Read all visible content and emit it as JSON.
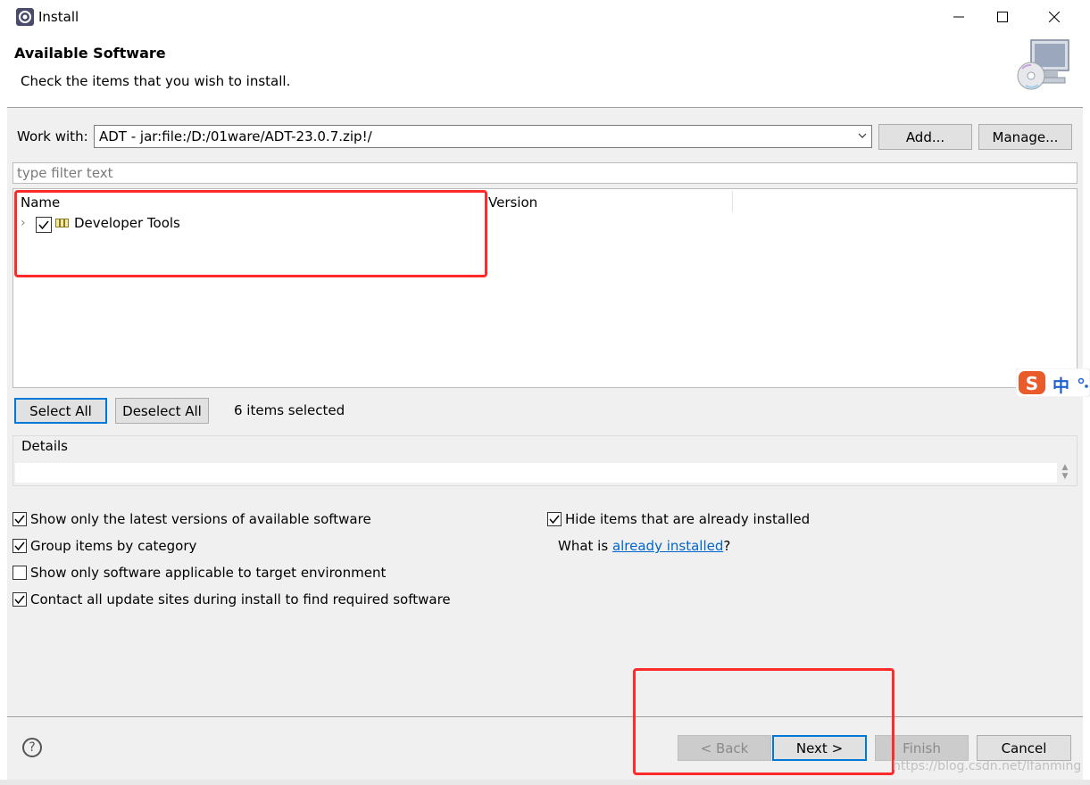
{
  "window": {
    "title": "Install"
  },
  "header": {
    "title": "Available Software",
    "description": "Check the items that you wish to install."
  },
  "work_with": {
    "label": "Work with:",
    "value": "ADT - jar:file:/D:/01ware/ADT-23.0.7.zip!/",
    "add_button": "Add...",
    "manage_button": "Manage..."
  },
  "filter": {
    "placeholder": "type filter text"
  },
  "tree": {
    "columns": [
      "Name",
      "Version"
    ],
    "rows": [
      {
        "label": "Developer Tools",
        "checked": true,
        "version": ""
      }
    ]
  },
  "selection": {
    "select_all": "Select All",
    "deselect_all": "Deselect All",
    "status": "6 items selected"
  },
  "details": {
    "label": "Details"
  },
  "options": [
    {
      "label": "Show only the latest versions of available software",
      "checked": true
    },
    {
      "label": "Group items by category",
      "checked": true
    },
    {
      "label": "Show only software applicable to target environment",
      "checked": false
    },
    {
      "label": "Contact all update sites during install to find required software",
      "checked": true
    },
    {
      "label": "Hide items that are already installed",
      "checked": true
    }
  ],
  "whatis": {
    "prefix": "What is ",
    "link": "already installed",
    "suffix": "?"
  },
  "footer": {
    "back": "< Back",
    "next": "Next >",
    "finish": "Finish",
    "cancel": "Cancel"
  },
  "ime": {
    "label": "中"
  },
  "watermark": "https://blog.csdn.net/lfanming",
  "colors": {
    "accent": "#0078d7",
    "annotation": "#ff2a2a",
    "link": "#0066cc"
  }
}
